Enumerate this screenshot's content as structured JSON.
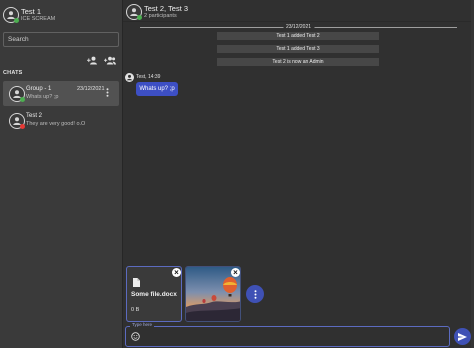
{
  "user": {
    "name": "Test 1",
    "status": "ICE SCREAM"
  },
  "search": {
    "placeholder": "Search"
  },
  "sidebar": {
    "add_user_icon": "person-add-icon",
    "add_group_icon": "group-add-icon",
    "chats_label": "CHATS",
    "chats": [
      {
        "name": "Group - 1",
        "message": "Whats up? ;p",
        "date": "23/12/2021",
        "status": "online",
        "active": true
      },
      {
        "name": "Test 2",
        "message": "They are very good! o.O",
        "date": "",
        "status": "offline",
        "active": false
      }
    ]
  },
  "conversation": {
    "title": "Test 2, Test 3",
    "participants": "2 participants",
    "date_separator": "23/12/2021",
    "system_messages": [
      "Test 1 added Test 2",
      "Test 1 added Test 3",
      "Test 2 is now an Admin"
    ],
    "message": {
      "meta": "Test, 14:39",
      "text": "Whats up? ;p"
    }
  },
  "attachments": {
    "file": {
      "name": "Some file.docx",
      "size": "0 B",
      "icon": "file-icon"
    },
    "image": {
      "description": "hot-air-balloon-image"
    },
    "close_label": "×"
  },
  "composer": {
    "label": "Type here",
    "value": "",
    "emoji_icon": "emoji-icon",
    "send_icon": "send-icon"
  },
  "colors": {
    "accent": "#3f51b5",
    "bubble": "#3d4fc4",
    "online": "#4caf50",
    "offline": "#e53935",
    "background": "#303030",
    "sidebar": "#3a3a3a"
  }
}
